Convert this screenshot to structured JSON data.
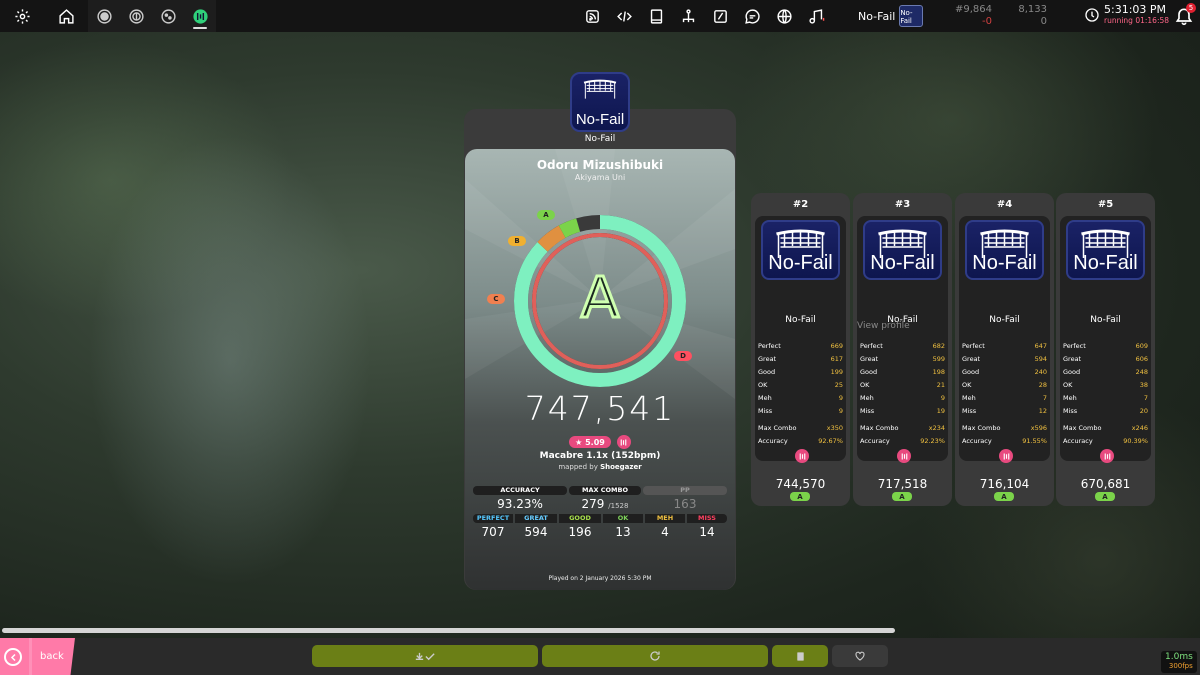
{
  "toolbar": {
    "mod_label": "No-Fail",
    "mod_badge_text": "No-Fail",
    "rank_global": "#9,864",
    "rank_global_change": "-0",
    "rank_country": "8,133",
    "rank_country_change": "0",
    "time": "5:31:03 PM",
    "running": "running 01:16:58",
    "notifications": "5"
  },
  "main": {
    "mod_icon_text": "No-Fail",
    "mod_name": "No-Fail",
    "song_title": "Odoru Mizushibuki",
    "artist": "Akiyama Uni",
    "grade": "A",
    "rank_labels": {
      "a": "A",
      "b": "B",
      "c": "C",
      "d": "D"
    },
    "score": "747,541",
    "star_rating": "★ 5.09",
    "difficulty": "Macabre 1.1x (152bpm)",
    "mapped_by_prefix": "mapped by ",
    "mapper": "Shoegazer",
    "accuracy_label": "ACCURACY",
    "accuracy": "93.23%",
    "max_combo_label": "MAX COMBO",
    "max_combo": "279",
    "max_combo_total": "/1528",
    "pp_label": "PP",
    "pp": "163",
    "judgements": [
      {
        "label": "PERFECT",
        "value": "707",
        "color": "#55c8ff"
      },
      {
        "label": "GREAT",
        "value": "594",
        "color": "#66ccff"
      },
      {
        "label": "GOOD",
        "value": "196",
        "color": "#a8e04a"
      },
      {
        "label": "OK",
        "value": "13",
        "color": "#7ed35a"
      },
      {
        "label": "MEH",
        "value": "4",
        "color": "#f0c040"
      },
      {
        "label": "MISS",
        "value": "14",
        "color": "#ff4060"
      }
    ],
    "played_on": "Played on 2 January 2026 5:30 PM"
  },
  "side_scores": [
    {
      "rank": "#2",
      "mod_icon_text": "No-Fail",
      "mod": "No-Fail",
      "perfect": "669",
      "great": "617",
      "good": "199",
      "ok": "25",
      "meh": "9",
      "miss": "9",
      "max_combo": "x350",
      "accuracy": "92.67%",
      "score": "744,570",
      "grade": "A"
    },
    {
      "rank": "#3",
      "mod_icon_text": "No-Fail",
      "mod": "No-Fail",
      "perfect": "682",
      "great": "599",
      "good": "198",
      "ok": "21",
      "meh": "9",
      "miss": "19",
      "max_combo": "x234",
      "accuracy": "92.23%",
      "score": "717,518",
      "grade": "A"
    },
    {
      "rank": "#4",
      "mod_icon_text": "No-Fail",
      "mod": "No-Fail",
      "perfect": "647",
      "great": "594",
      "good": "240",
      "ok": "28",
      "meh": "7",
      "miss": "12",
      "max_combo": "x596",
      "accuracy": "91.55%",
      "score": "716,104",
      "grade": "A"
    },
    {
      "rank": "#5",
      "mod_icon_text": "No-Fail",
      "mod": "No-Fail",
      "perfect": "609",
      "great": "606",
      "good": "248",
      "ok": "38",
      "meh": "7",
      "miss": "20",
      "max_combo": "x246",
      "accuracy": "90.39%",
      "score": "670,681",
      "grade": "A"
    }
  ],
  "side_labels": {
    "perfect": "Perfect",
    "great": "Great",
    "good": "Good",
    "ok": "OK",
    "meh": "Meh",
    "miss": "Miss",
    "max_combo": "Max Combo",
    "accuracy": "Accuracy"
  },
  "tooltip": "View profile",
  "footer": {
    "back_label": "back",
    "frame_time": "1.0ms",
    "fps": "300fps"
  },
  "colors": {
    "accent_pink": "#ff7aa8",
    "footer_green": "#6b7f16",
    "grade_a": "#7bd34a",
    "accuracy_ring": "#6ae0f0"
  }
}
